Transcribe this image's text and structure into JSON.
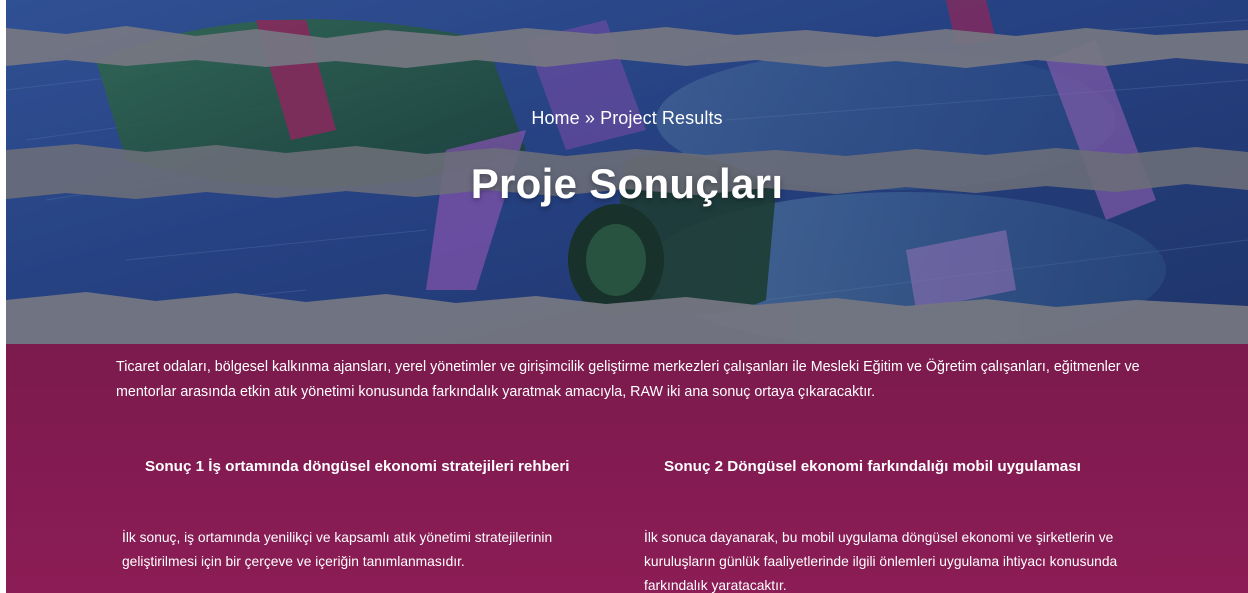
{
  "breadcrumb": {
    "home": "Home",
    "separator": "»",
    "current": "Project Results"
  },
  "page_title": "Proje Sonuçları",
  "intro": "Ticaret odaları, bölgesel kalkınma ajansları, yerel yönetimler ve girişimcilik geliştirme merkezleri çalışanları ile Mesleki Eğitim ve Öğretim çalışanları, eğitmenler ve mentorlar arasında etkin atık yönetimi konusunda farkındalık yaratmak amacıyla, RAW iki ana sonuç ortaya çıkaracaktır.",
  "results": [
    {
      "title": "Sonuç 1 İş ortamında döngüsel ekonomi stratejileri rehberi",
      "description": "İlk sonuç, iş ortamında yenilikçi ve kapsamlı atık yönetimi stratejilerinin geliştirilmesi için bir çerçeve ve içeriğin tanımlanmasıdır."
    },
    {
      "title": "Sonuç 2 Döngüsel ekonomi farkındalığı mobil uygulaması",
      "description": "İlk sonuca dayanarak, bu mobil uygulama döngüsel ekonomi ve şirketlerin ve kuruluşların günlük faaliyetlerinde ilgili önlemleri uygulama ihtiyacı konusunda farkındalık yaratacaktır."
    }
  ],
  "colors": {
    "content_bg": "#841b52",
    "hero_blue": "#2a4680",
    "text": "#ffffff"
  }
}
